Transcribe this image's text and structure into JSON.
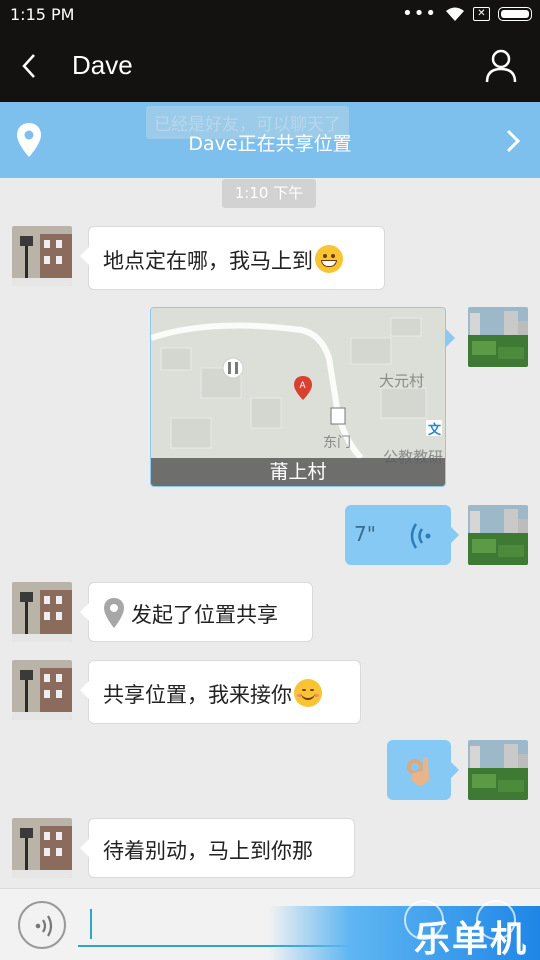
{
  "status_bar": {
    "time": "1:15 PM",
    "icons": [
      "more-dots-icon",
      "wifi-icon",
      "sim-icon",
      "battery-icon"
    ]
  },
  "header": {
    "title": "Dave",
    "back_icon": "chevron-left-icon",
    "profile_icon": "person-icon"
  },
  "banner": {
    "ghost_text": "已经是好友，可以聊天了",
    "text": "Dave正在共享位置",
    "pin_icon": "location-pin-icon",
    "arrow_icon": "chevron-right-icon",
    "color": "#7dc0ee"
  },
  "messages": {
    "timestamp": "1:10 下午",
    "m1_text": "地点定在哪，我马上到",
    "m1_emoji": "grin-emoji",
    "map": {
      "caption": "莆上村",
      "labels": {
        "village": "大元村",
        "gate": "东门",
        "school": "公教教研"
      },
      "marker": "A"
    },
    "voice_duration": "7\"",
    "voice_icon": "voice-wave-icon",
    "m4_text": "发起了位置共享",
    "m4_icon": "location-pin-icon",
    "m5_text": "共享位置，我来接你",
    "m5_emoji": "blush-smile-emoji",
    "m6_emoji": "ok-hand-emoji",
    "m7_text": "待着别动，马上到你那"
  },
  "input_bar": {
    "voice_toggle_icon": "voice-icon",
    "placeholder": ""
  },
  "watermark": {
    "text": "乐单机"
  },
  "colors": {
    "dark_bar": "#141210",
    "chat_bg": "#ebebeb",
    "sent_bubble": "#86c9f4",
    "accent": "#2ea6c8"
  }
}
